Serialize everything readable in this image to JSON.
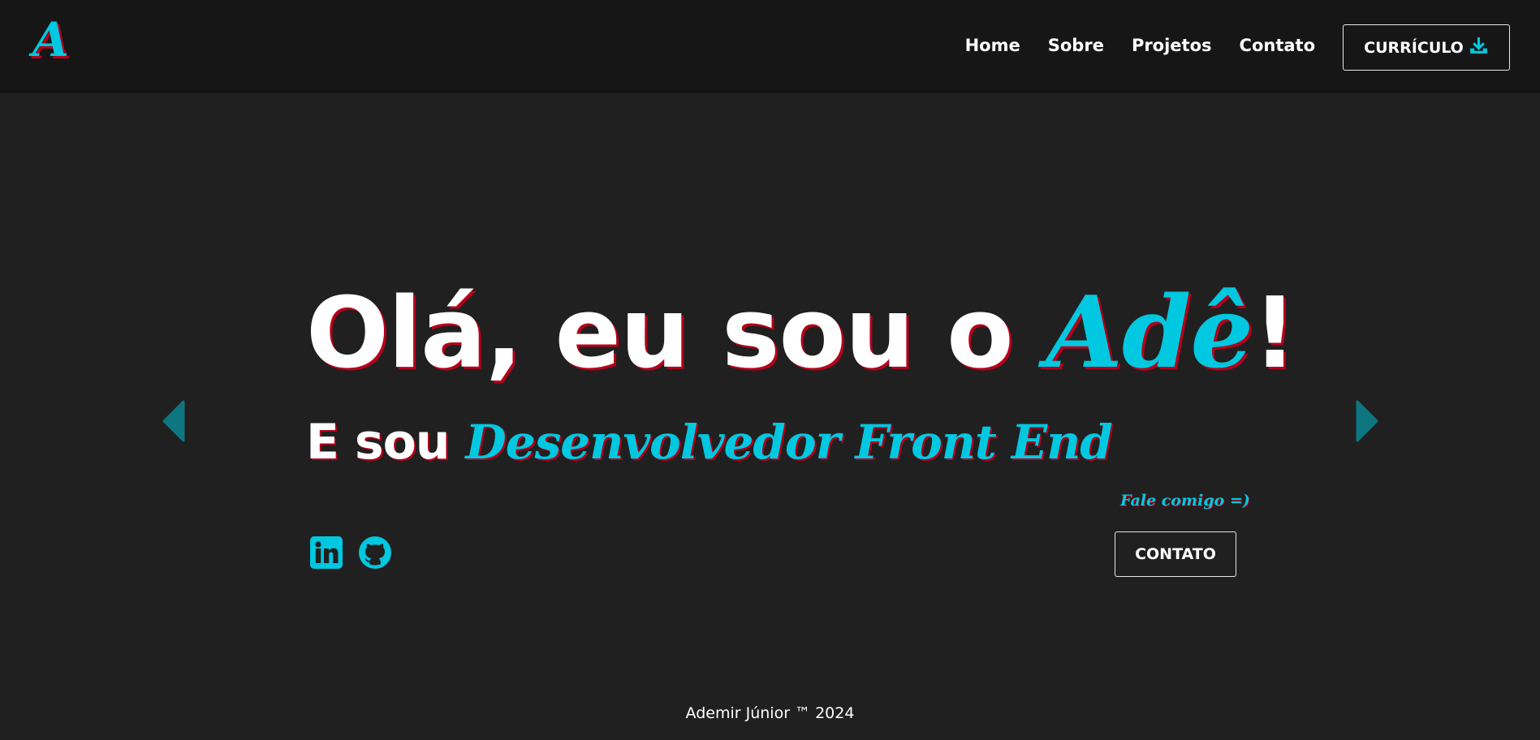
{
  "header": {
    "logo": "A",
    "nav": [
      "Home",
      "Sobre",
      "Projetos",
      "Contato"
    ],
    "cv_label": "CURRÍCULO"
  },
  "hero": {
    "title_prefix": "Olá, eu sou o ",
    "title_name": "Adê",
    "title_suffix": "!",
    "sub_prefix": "E sou ",
    "sub_role": "Desenvolvedor Front End",
    "talk_label": "Fale comigo =)",
    "contact_label": "CONTATO"
  },
  "footer": {
    "text": "Ademir Júnior ™ 2024"
  },
  "icons": {
    "download": "download-icon",
    "linkedin": "linkedin-icon",
    "github": "github-icon",
    "prev": "caret-left-icon",
    "next": "caret-right-icon"
  },
  "colors": {
    "accent": "#00c8e0",
    "shadow": "#b5001a",
    "background": "#202020",
    "header": "#161616"
  }
}
